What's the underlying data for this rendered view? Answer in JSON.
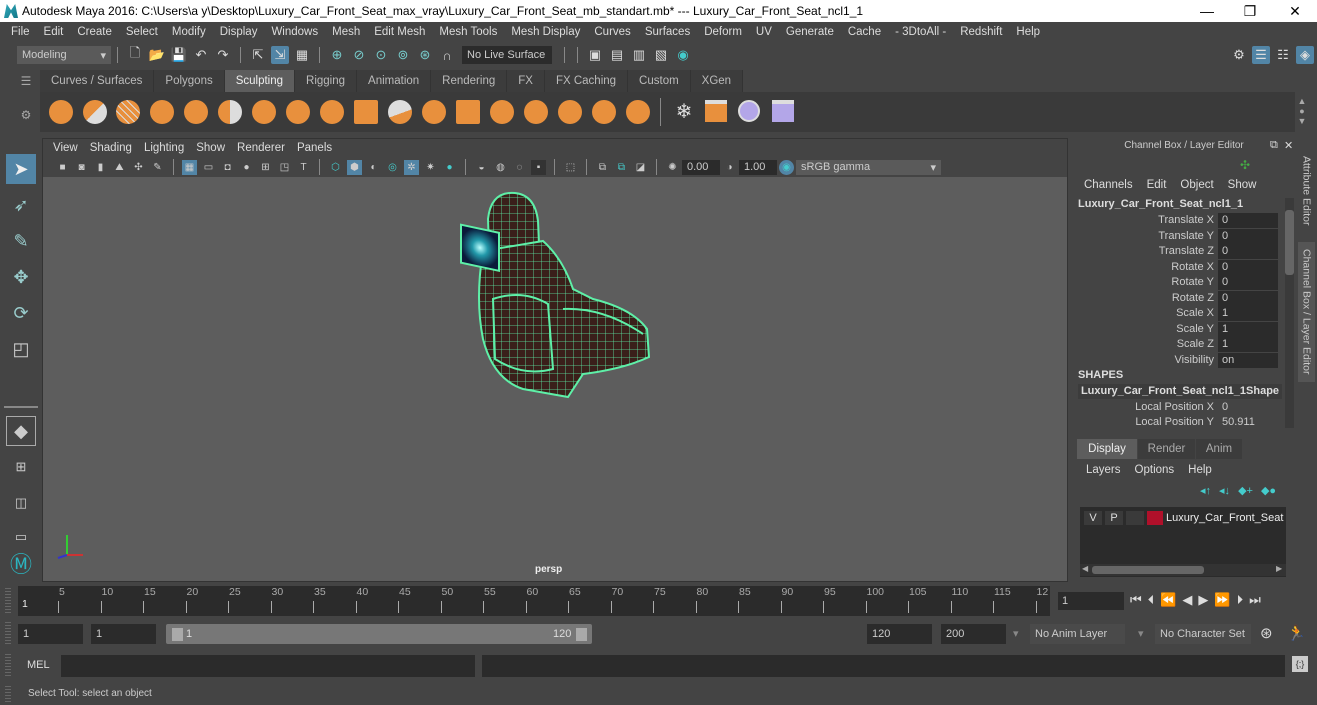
{
  "window": {
    "title": "Autodesk Maya 2016: C:\\Users\\a y\\Desktop\\Luxury_Car_Front_Seat_max_vray\\Luxury_Car_Front_Seat_mb_standart.mb*  ---  Luxury_Car_Front_Seat_ncl1_1",
    "minimize": "—",
    "maximize": "❐",
    "close": "✕"
  },
  "menubar": [
    "File",
    "Edit",
    "Create",
    "Select",
    "Modify",
    "Display",
    "Windows",
    "Mesh",
    "Edit Mesh",
    "Mesh Tools",
    "Mesh Display",
    "Curves",
    "Surfaces",
    "Deform",
    "UV",
    "Generate",
    "Cache",
    "- 3DtoAll -",
    "Redshift",
    "Help"
  ],
  "status_line": {
    "mode": "Modeling",
    "live_surface": "No Live Surface"
  },
  "shelf_tabs": [
    "Curves / Surfaces",
    "Polygons",
    "Sculpting",
    "Rigging",
    "Animation",
    "Rendering",
    "FX",
    "FX Caching",
    "Custom",
    "XGen"
  ],
  "active_shelf_tab": "Sculpting",
  "viewport": {
    "menu": [
      "View",
      "Shading",
      "Lighting",
      "Show",
      "Renderer",
      "Panels"
    ],
    "exposure": "0.00",
    "gamma": "1.00",
    "color_space": "sRGB gamma",
    "camera_label": "persp",
    "wire_color": "#5ef0a8",
    "mesh_color": "#3a1f1a",
    "background": "#5d5d5d"
  },
  "channel_box": {
    "title": "Channel Box / Layer Editor",
    "menu": [
      "Channels",
      "Edit",
      "Object",
      "Show"
    ],
    "object_name": "Luxury_Car_Front_Seat_ncl1_1",
    "channels": [
      {
        "label": "Translate X",
        "value": "0"
      },
      {
        "label": "Translate Y",
        "value": "0"
      },
      {
        "label": "Translate Z",
        "value": "0"
      },
      {
        "label": "Rotate X",
        "value": "0"
      },
      {
        "label": "Rotate Y",
        "value": "0"
      },
      {
        "label": "Rotate Z",
        "value": "0"
      },
      {
        "label": "Scale X",
        "value": "1"
      },
      {
        "label": "Scale Y",
        "value": "1"
      },
      {
        "label": "Scale Z",
        "value": "1"
      },
      {
        "label": "Visibility",
        "value": "on"
      }
    ],
    "shapes_header": "SHAPES",
    "shape_name": "Luxury_Car_Front_Seat_ncl1_1Shape",
    "shape_channels": [
      {
        "label": "Local Position X",
        "value": "0"
      },
      {
        "label": "Local Position Y",
        "value": "50.911"
      }
    ]
  },
  "side_tabs": [
    "Attribute Editor",
    "Channel Box / Layer Editor"
  ],
  "layer_editor": {
    "tabs": [
      "Display",
      "Render",
      "Anim"
    ],
    "active_tab": "Display",
    "menu": [
      "Layers",
      "Options",
      "Help"
    ],
    "layers": [
      {
        "v": "V",
        "p": "P",
        "color": "#b0102a",
        "name": "Luxury_Car_Front_Seat"
      }
    ]
  },
  "timeline": {
    "ticks": [
      "5",
      "10",
      "15",
      "20",
      "25",
      "30",
      "35",
      "40",
      "45",
      "50",
      "55",
      "60",
      "65",
      "70",
      "75",
      "80",
      "85",
      "90",
      "95",
      "100",
      "105",
      "110",
      "115",
      "12"
    ],
    "current_frame_marker": "1",
    "current_frame": "1"
  },
  "range": {
    "start": "1",
    "playback_start": "1",
    "slider_start": "1",
    "slider_end": "120",
    "playback_end": "120",
    "end": "200",
    "anim_layer": "No Anim Layer",
    "character_set": "No Character Set"
  },
  "command_line": {
    "label": "MEL",
    "value": ""
  },
  "help_line": "Select Tool: select an object"
}
